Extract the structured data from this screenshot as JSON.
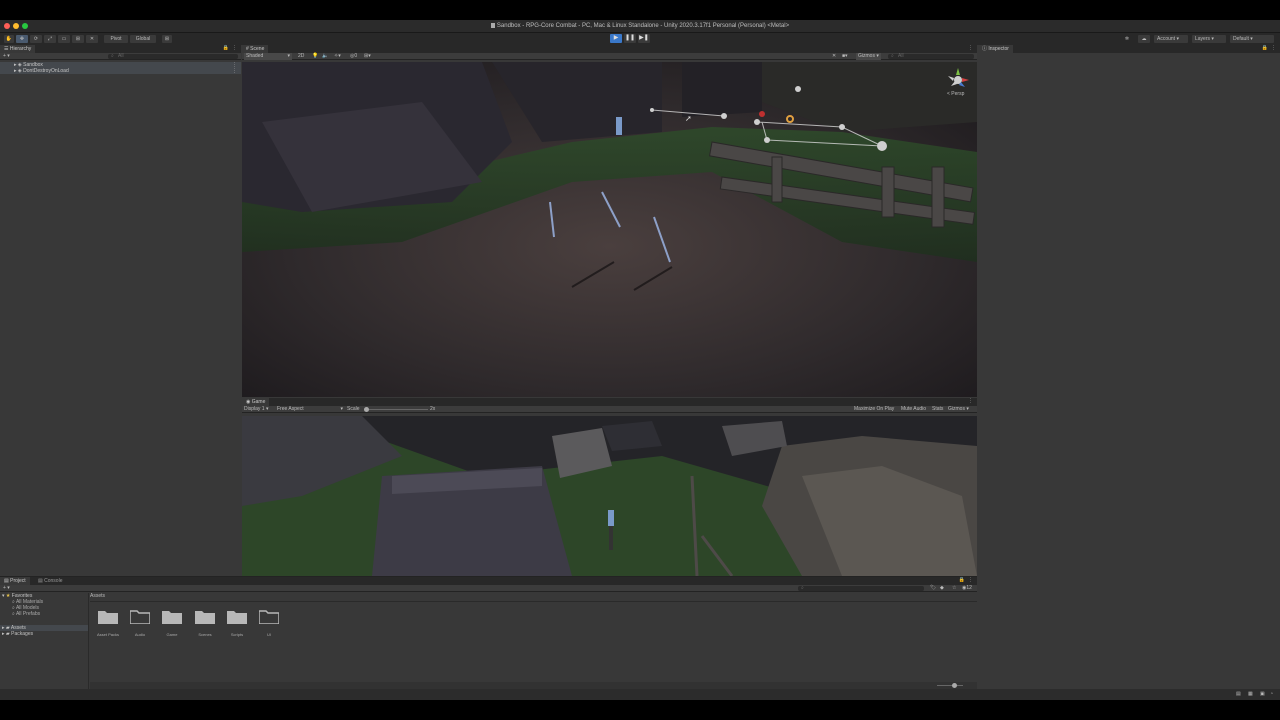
{
  "window": {
    "title": "Sandbox - RPG-Core Combat - PC, Mac & Linux Standalone - Unity 2020.3.17f1 Personal (Personal) <Metal>"
  },
  "toolbar": {
    "pivot_label": "Pivot",
    "global_label": "Global",
    "account_label": "Account",
    "layers_label": "Layers",
    "layout_label": "Default",
    "play_icon": "play-icon",
    "pause_icon": "pause-icon",
    "step_icon": "step-icon"
  },
  "hierarchy": {
    "tab_label": "Hierarchy",
    "search_placeholder": "All",
    "items": [
      {
        "label": "Sandbox"
      },
      {
        "label": "DontDestroyOnLoad"
      }
    ]
  },
  "scene": {
    "tab_label": "Scene",
    "shading_mode": "Shaded",
    "dimension_toggle": "2D",
    "gizmos_label": "Gizmos",
    "search_placeholder": "All",
    "projection_label": "< Persp"
  },
  "game": {
    "tab_label": "Game",
    "display_label": "Display 1",
    "aspect_label": "Free Aspect",
    "scale_label": "Scale",
    "scale_value": "2x",
    "maximize_label": "Maximize On Play",
    "mute_label": "Mute Audio",
    "stats_label": "Stats",
    "gizmos_label": "Gizmos"
  },
  "inspector": {
    "tab_label": "Inspector"
  },
  "project": {
    "tab_label": "Project",
    "console_tab_label": "Console",
    "breadcrumb": "Assets",
    "hidden_count": "12",
    "favorites_label": "Favorites",
    "favorites": [
      {
        "label": "All Materials"
      },
      {
        "label": "All Models"
      },
      {
        "label": "All Prefabs"
      }
    ],
    "roots": [
      {
        "label": "Assets"
      },
      {
        "label": "Packages"
      }
    ],
    "folders": [
      {
        "label": "Asset Packs"
      },
      {
        "label": "Audio"
      },
      {
        "label": "Game"
      },
      {
        "label": "Scenes"
      },
      {
        "label": "Scripts"
      },
      {
        "label": "UI"
      }
    ]
  },
  "colors": {
    "accent_play": "#3a78c9",
    "selection": "#44484d",
    "panel_bg": "#383838",
    "toolbar_bg": "#282828"
  }
}
